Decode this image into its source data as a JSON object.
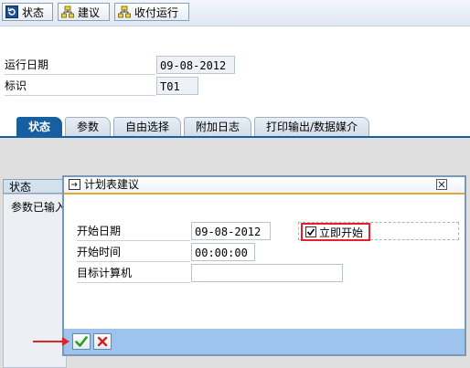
{
  "toolbar": {
    "status_label": "状态",
    "suggest_label": "建议",
    "payment_run_label": "收付运行"
  },
  "form": {
    "run_date_label": "运行日期",
    "run_date_value": "09-08-2012",
    "id_label": "标识",
    "id_value": "T01"
  },
  "tabs": [
    {
      "label": "状态"
    },
    {
      "label": "参数"
    },
    {
      "label": "自由选择"
    },
    {
      "label": "附加日志"
    },
    {
      "label": "打印输出/数据媒介"
    }
  ],
  "status_panel": {
    "tab_label": "状态",
    "text": "参数已输入"
  },
  "dialog": {
    "title": "计划表建议",
    "start_date_label": "开始日期",
    "start_date_value": "09-08-2012",
    "start_time_label": "开始时间",
    "start_time_value": "00:00:00",
    "target_computer_label": "目标计算机",
    "target_computer_value": "",
    "start_immediately_label": "立即开始",
    "start_immediately_checked": true
  },
  "colors": {
    "accent": "#165fa0",
    "highlight": "#e8202a",
    "footer": "#9ec3ec",
    "title_underline": "#e7a82e"
  }
}
